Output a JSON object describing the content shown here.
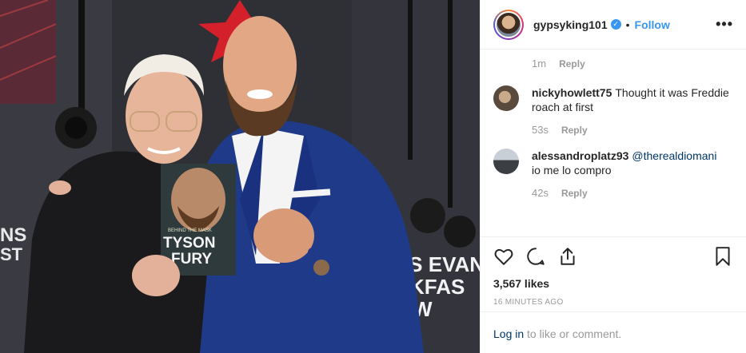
{
  "post": {
    "username": "gypsyking101",
    "verified_glyph": "✓",
    "separator": "•",
    "follow_label": "Follow",
    "more_label": "•••"
  },
  "comments": {
    "first_meta": {
      "time": "1m",
      "reply": "Reply"
    },
    "items": [
      {
        "user": "nickyhowlett75",
        "text": "Thought it was Freddie roach at first",
        "time": "53s",
        "reply": "Reply"
      },
      {
        "user": "alessandroplatz93",
        "mention": "@therealdiomani",
        "text": "io me lo compro",
        "time": "42s",
        "reply": "Reply"
      }
    ]
  },
  "actions": {
    "icons": [
      "heart-icon",
      "comment-icon",
      "share-icon",
      "bookmark-icon"
    ],
    "likes": "3,567 likes",
    "posted_ago": "16 MINUTES AGO"
  },
  "login": {
    "link_text": "Log in",
    "suffix": " to like or comment."
  },
  "photo": {
    "book_top_text": "BEHIND THE MASK",
    "book_title_1": "TYSON",
    "book_title_2": "FURY",
    "backdrop_left": "NS\nST",
    "backdrop_right_1": "'S EVAN",
    "backdrop_right_2": "KFAS",
    "backdrop_right_3": "W"
  }
}
